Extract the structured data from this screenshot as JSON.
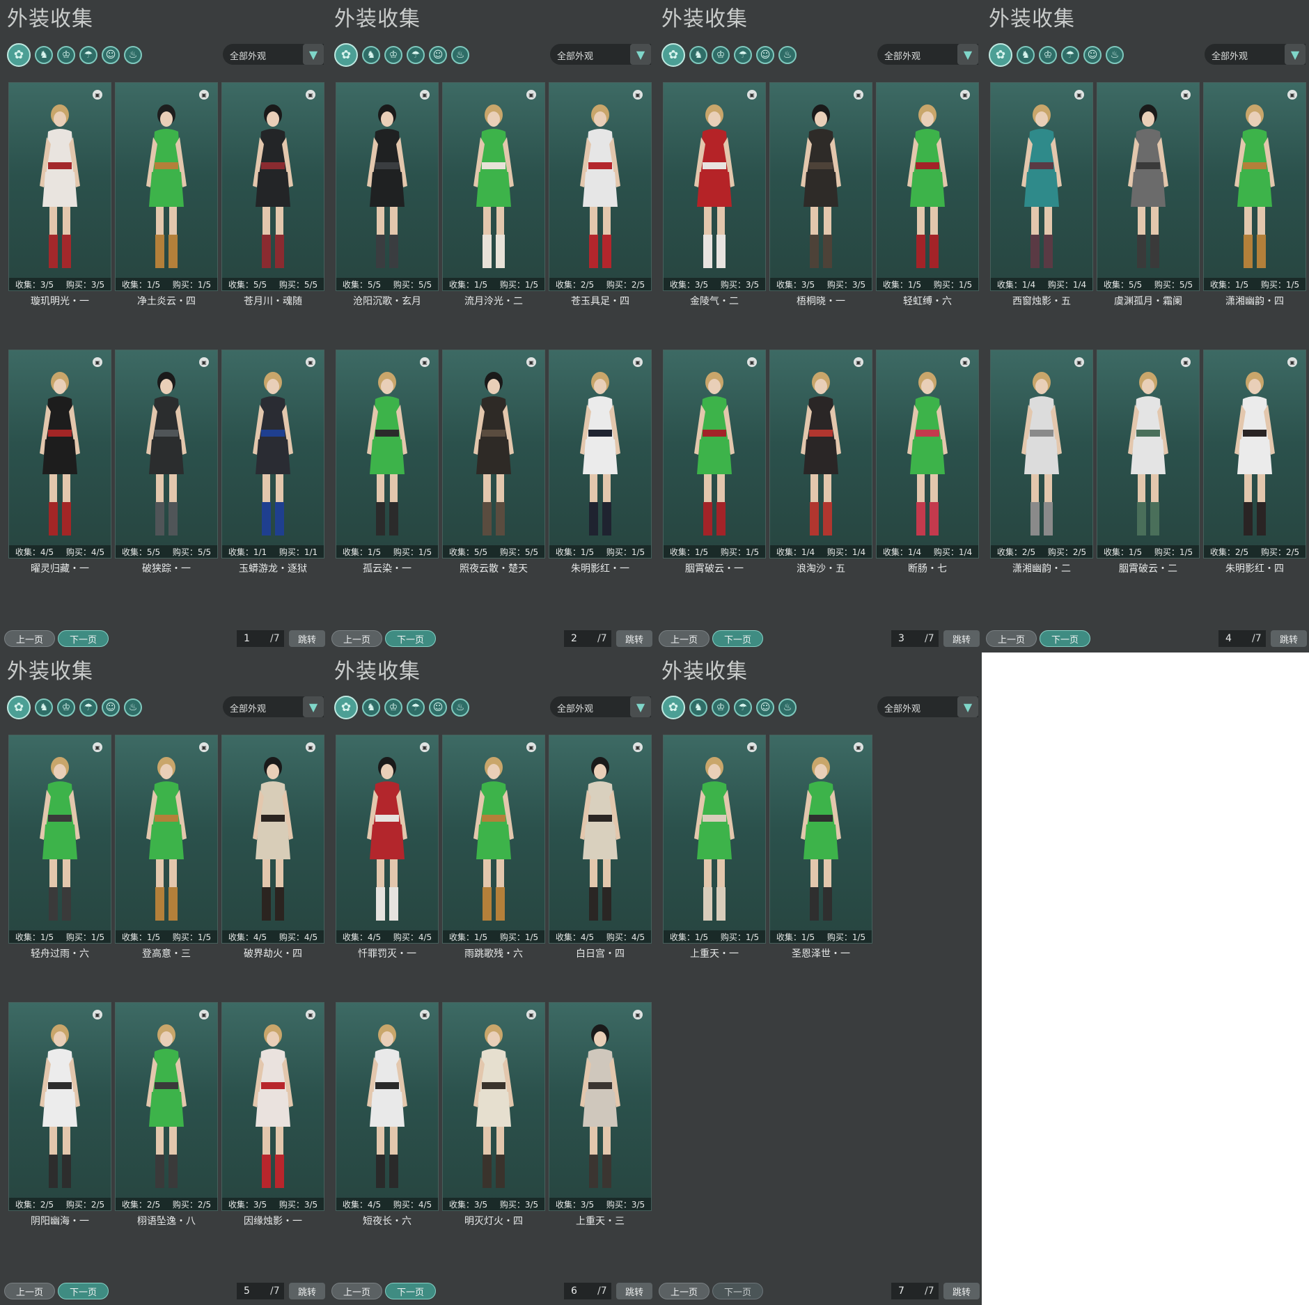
{
  "app": {
    "panel_title": "外装收集",
    "dropdown_label": "全部外观",
    "prev_label": "上一页",
    "next_label": "下一页",
    "jump_label": "跳转"
  },
  "filter_icons": [
    "outfit-all-icon",
    "top-icon",
    "torso-icon",
    "hat-icon",
    "face-icon",
    "boots-icon"
  ],
  "colors": {
    "panel_bg": "#3a3d3e",
    "accent": "#3f8c82",
    "card_bg": "#2e5550"
  },
  "panels": [
    {
      "page": "1",
      "total": "/7",
      "cards": [
        {
          "name": "璇玑明光・一",
          "collect": "收集：3/5",
          "buy": "购买：3/5",
          "outfit": "#e9e4df",
          "accent": "#a3282b",
          "hair": "#c9a66b"
        },
        {
          "name": "净土炎云・四",
          "collect": "收集：1/5",
          "buy": "购买：1/5",
          "outfit": "#3db34a",
          "accent": "#b4803a",
          "hair": "#1e1e1e"
        },
        {
          "name": "苍月川・魂随",
          "collect": "收集：5/5",
          "buy": "购买：5/5",
          "outfit": "#232527",
          "accent": "#8a2b30",
          "hair": "#1a1a1a"
        },
        {
          "name": "曜灵归藏・一",
          "collect": "收集：4/5",
          "buy": "购买：4/5",
          "outfit": "#1d1d1d",
          "accent": "#a32626",
          "hair": "#c9a66b"
        },
        {
          "name": "破狭踪・一",
          "collect": "收集：5/5",
          "buy": "购买：5/5",
          "outfit": "#2b2d2e",
          "accent": "#505558",
          "hair": "#1a1a1a"
        },
        {
          "name": "玉蟒游龙・逐狱",
          "collect": "收集：1/1",
          "buy": "购买：1/1",
          "outfit": "#2a2c33",
          "accent": "#1f3f8f",
          "hair": "#c9a66b"
        }
      ]
    },
    {
      "page": "2",
      "total": "/7",
      "cards": [
        {
          "name": "沧阳沉歌・玄月",
          "collect": "收集：5/5",
          "buy": "购买：5/5",
          "outfit": "#1f2122",
          "accent": "#3a3d40",
          "hair": "#1a1a1a"
        },
        {
          "name": "流月泠光・二",
          "collect": "收集：1/5",
          "buy": "购买：1/5",
          "outfit": "#3db34a",
          "accent": "#e8e2d8",
          "hair": "#c9a66b"
        },
        {
          "name": "苍玉具足・四",
          "collect": "收集：2/5",
          "buy": "购买：2/5",
          "outfit": "#e6e6e6",
          "accent": "#b3262c",
          "hair": "#c9a66b"
        },
        {
          "name": "孤云染・一",
          "collect": "收集：1/5",
          "buy": "购买：1/5",
          "outfit": "#3db34a",
          "accent": "#2b2b2b",
          "hair": "#c9a66b"
        },
        {
          "name": "照夜云散・楚天",
          "collect": "收集：5/5",
          "buy": "购买：5/5",
          "outfit": "#2e2a26",
          "accent": "#5a4c3f",
          "hair": "#1a1a1a"
        },
        {
          "name": "朱明影红・一",
          "collect": "收集：1/5",
          "buy": "购买：1/5",
          "outfit": "#ebebeb",
          "accent": "#1f2330",
          "hair": "#c9a66b"
        }
      ]
    },
    {
      "page": "3",
      "total": "/7",
      "cards": [
        {
          "name": "金陵气・二",
          "collect": "收集：3/5",
          "buy": "购买：3/5",
          "outfit": "#b52327",
          "accent": "#e8e4e0",
          "hair": "#c9a66b"
        },
        {
          "name": "梧桐晓・一",
          "collect": "收集：3/5",
          "buy": "购买：3/5",
          "outfit": "#2e2b28",
          "accent": "#4d4238",
          "hair": "#1a1a1a"
        },
        {
          "name": "轻虹缚・六",
          "collect": "收集：1/5",
          "buy": "购买：1/5",
          "outfit": "#3db34a",
          "accent": "#a32328",
          "hair": "#c9a66b"
        },
        {
          "name": "胭霄破云・一",
          "collect": "收集：1/5",
          "buy": "购买：1/5",
          "outfit": "#3db34a",
          "accent": "#a32328",
          "hair": "#c9a66b"
        },
        {
          "name": "浪淘沙・五",
          "collect": "收集：1/4",
          "buy": "购买：1/4",
          "outfit": "#2a2626",
          "accent": "#b1362f",
          "hair": "#c9a66b"
        },
        {
          "name": "断肠・七",
          "collect": "收集：1/4",
          "buy": "购买：1/4",
          "outfit": "#3db34a",
          "accent": "#c43a4d",
          "hair": "#c9a66b"
        }
      ]
    },
    {
      "page": "4",
      "total": "/7",
      "cards": [
        {
          "name": "西窗烛影・五",
          "collect": "收集：1/4",
          "buy": "购买：1/4",
          "outfit": "#2f8a8a",
          "accent": "#5a3a44",
          "hair": "#c9a66b"
        },
        {
          "name": "虞渊孤月・霜阑",
          "collect": "收集：5/5",
          "buy": "购买：5/5",
          "outfit": "#6b6b6b",
          "accent": "#3a3a3a",
          "hair": "#1a1a1a"
        },
        {
          "name": "潇湘幽韵・四",
          "collect": "收集：1/5",
          "buy": "购买：1/5",
          "outfit": "#3db34a",
          "accent": "#b4803a",
          "hair": "#c9a66b"
        },
        {
          "name": "潇湘幽韵・二",
          "collect": "收集：2/5",
          "buy": "购买：2/5",
          "outfit": "#dcdcdc",
          "accent": "#8a8a8a",
          "hair": "#c9a66b"
        },
        {
          "name": "胭霄破云・二",
          "collect": "收集：1/5",
          "buy": "购买：1/5",
          "outfit": "#e4e4e4",
          "accent": "#4a6f5a",
          "hair": "#c9a66b"
        },
        {
          "name": "朱明影红・四",
          "collect": "收集：2/5",
          "buy": "购买：2/5",
          "outfit": "#ebebeb",
          "accent": "#2a2424",
          "hair": "#c9a66b"
        }
      ]
    },
    {
      "page": "5",
      "total": "/7",
      "cards": [
        {
          "name": "轻舟过雨・六",
          "collect": "收集：1/5",
          "buy": "购买：1/5",
          "outfit": "#3db34a",
          "accent": "#3a3a3a",
          "hair": "#c9a66b"
        },
        {
          "name": "登高意・三",
          "collect": "收集：1/5",
          "buy": "购买：1/5",
          "outfit": "#3db34a",
          "accent": "#b4803a",
          "hair": "#c9a66b"
        },
        {
          "name": "破界劫火・四",
          "collect": "收集：4/5",
          "buy": "购买：4/5",
          "outfit": "#d8cdb8",
          "accent": "#2b2420",
          "hair": "#1a1a1a"
        },
        {
          "name": "阴阳幽海・一",
          "collect": "收集：2/5",
          "buy": "购买：2/5",
          "outfit": "#ececec",
          "accent": "#2d2d2d",
          "hair": "#c9a66b"
        },
        {
          "name": "栩语坠逸・八",
          "collect": "收集：2/5",
          "buy": "购买：2/5",
          "outfit": "#3db34a",
          "accent": "#3a3a3a",
          "hair": "#c9a66b"
        },
        {
          "name": "因缘烛影・一",
          "collect": "收集：3/5",
          "buy": "购买：3/5",
          "outfit": "#eae2de",
          "accent": "#b8262c",
          "hair": "#c9a66b"
        }
      ]
    },
    {
      "page": "6",
      "total": "/7",
      "cards": [
        {
          "name": "忏罪罚灭・一",
          "collect": "收集：4/5",
          "buy": "购买：4/5",
          "outfit": "#b3262c",
          "accent": "#e6e3df",
          "hair": "#1a1a1a"
        },
        {
          "name": "雨跳歌残・六",
          "collect": "收集：1/5",
          "buy": "购买：1/5",
          "outfit": "#3db34a",
          "accent": "#b4803a",
          "hair": "#c9a66b"
        },
        {
          "name": "白日宫・四",
          "collect": "收集：4/5",
          "buy": "购买：4/5",
          "outfit": "#d9d0be",
          "accent": "#2a2624",
          "hair": "#1a1a1a"
        },
        {
          "name": "短夜长・六",
          "collect": "收集：4/5",
          "buy": "购买：4/5",
          "outfit": "#e9e9e9",
          "accent": "#2a2a2a",
          "hair": "#c9a66b"
        },
        {
          "name": "明灭灯火・四",
          "collect": "收集：3/5",
          "buy": "购买：3/5",
          "outfit": "#e6dfcf",
          "accent": "#3a332c",
          "hair": "#c9a66b"
        },
        {
          "name": "上重天・三",
          "collect": "收集：3/5",
          "buy": "购买：3/5",
          "outfit": "#cfc7bc",
          "accent": "#3b3531",
          "hair": "#1a1a1a"
        }
      ]
    },
    {
      "page": "7",
      "total": "/7",
      "cards": [
        {
          "name": "上重天・一",
          "collect": "收集：1/5",
          "buy": "购买：1/5",
          "outfit": "#3db34a",
          "accent": "#d9cdbb",
          "hair": "#c9a66b"
        },
        {
          "name": "圣恩泽世・一",
          "collect": "收集：1/5",
          "buy": "购买：1/5",
          "outfit": "#3db34a",
          "accent": "#2f2f2f",
          "hair": "#c9a66b"
        }
      ]
    }
  ]
}
